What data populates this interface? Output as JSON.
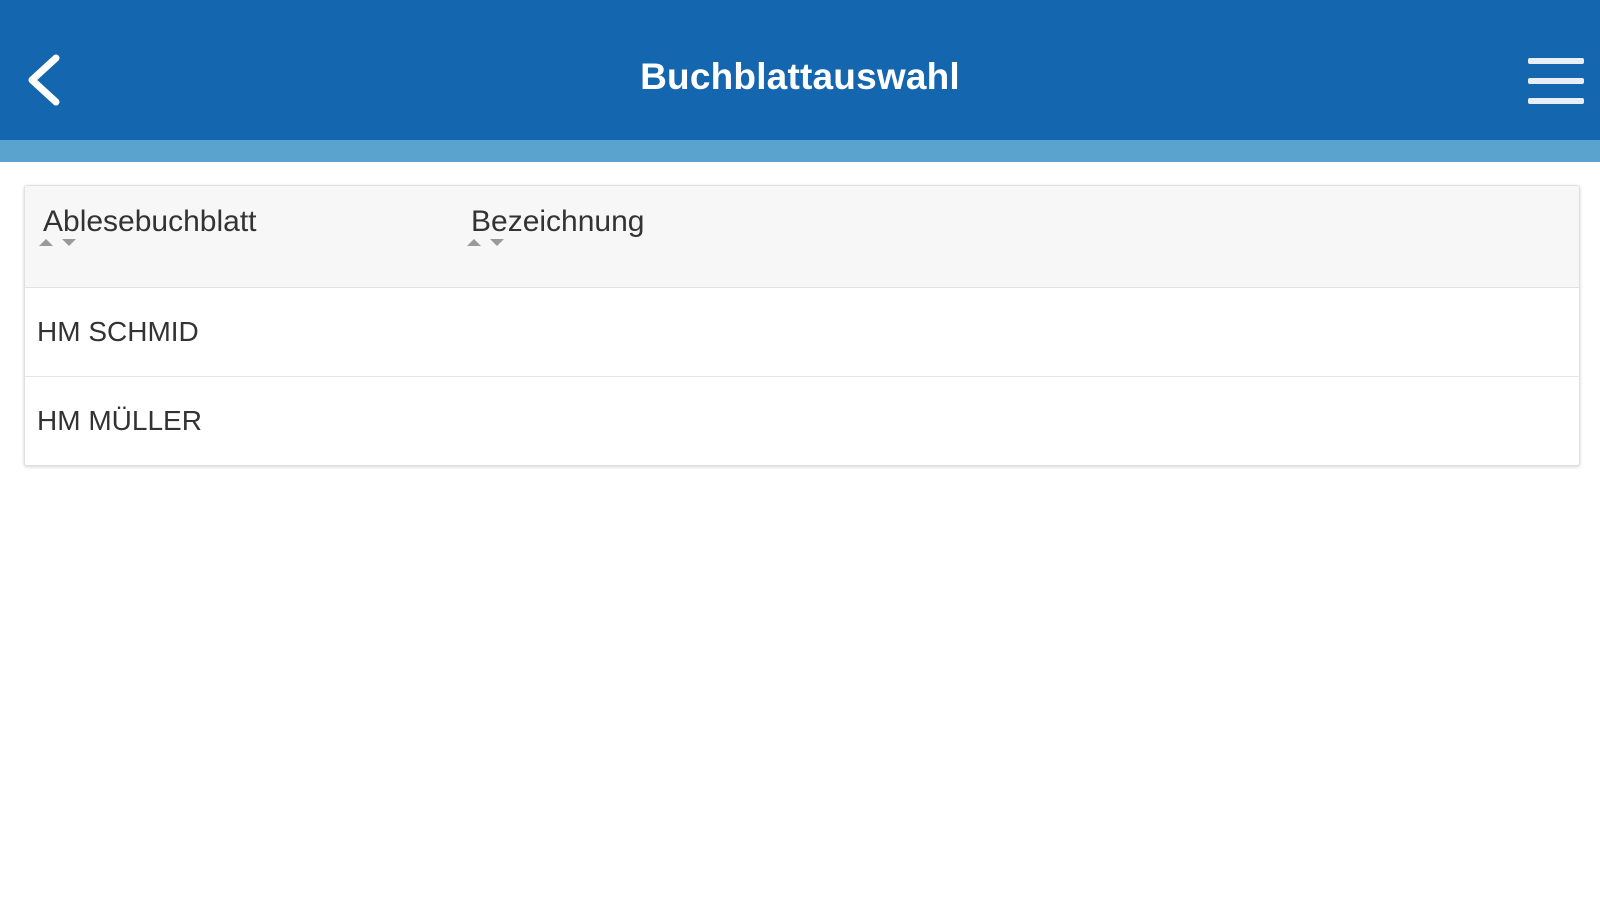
{
  "header": {
    "title": "Buchblattauswahl",
    "background_color": "#1466ae",
    "stripe_color": "#5aa3cf",
    "back_icon": "chevron-left-icon",
    "menu_icon": "hamburger-menu-icon"
  },
  "table": {
    "columns": [
      {
        "label": "Ablesebuchblatt",
        "sort_icon": "sort-arrows-icon"
      },
      {
        "label": "Bezeichnung",
        "sort_icon": "sort-arrows-icon"
      }
    ],
    "rows": [
      {
        "ablesebuchblatt": "HM SCHMID",
        "bezeichnung": ""
      },
      {
        "ablesebuchblatt": "HM MÜLLER",
        "bezeichnung": ""
      }
    ]
  }
}
